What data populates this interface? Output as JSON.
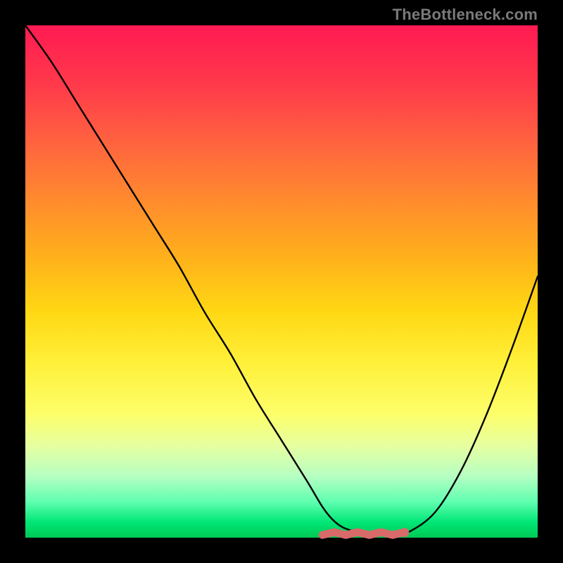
{
  "watermark": "TheBottleneck.com",
  "chart_data": {
    "type": "line",
    "title": "",
    "xlabel": "",
    "ylabel": "",
    "xlim": [
      0,
      100
    ],
    "ylim": [
      0,
      100
    ],
    "x": [
      0,
      5,
      10,
      15,
      20,
      25,
      30,
      35,
      40,
      45,
      50,
      55,
      58,
      60,
      62,
      65,
      67,
      70,
      72,
      75,
      80,
      85,
      90,
      95,
      100
    ],
    "values": [
      100,
      93,
      85,
      77,
      69,
      61,
      53,
      44,
      36,
      27,
      19,
      11,
      6,
      3.5,
      2,
      1,
      0.7,
      0.6,
      0.7,
      1.2,
      5,
      13,
      24,
      37,
      51
    ],
    "optimal_marker": {
      "x_range": [
        58,
        74
      ],
      "y": 0.8,
      "endpoint_x": 74,
      "endpoint_y": 1.0,
      "color": "#d86a6a"
    },
    "curve_color": "#000000",
    "gradient_stops": [
      {
        "pos": 0,
        "color": "#ff1a52"
      },
      {
        "pos": 50,
        "color": "#ffd814"
      },
      {
        "pos": 80,
        "color": "#fdff6b"
      },
      {
        "pos": 100,
        "color": "#00c853"
      }
    ]
  }
}
